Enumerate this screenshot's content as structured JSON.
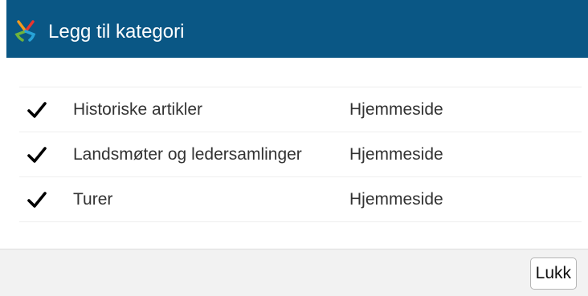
{
  "dialog": {
    "title": "Legg til kategori",
    "logo_icon": "star-logo-icon",
    "header_color": "#0a5785"
  },
  "categories": [
    {
      "checked": true,
      "name": "Historiske artikler",
      "site": "Hjemmeside"
    },
    {
      "checked": true,
      "name": "Landsmøter og ledersamlinger",
      "site": "Hjemmeside"
    },
    {
      "checked": true,
      "name": "Turer",
      "site": "Hjemmeside"
    }
  ],
  "footer": {
    "close_label": "Lukk"
  }
}
